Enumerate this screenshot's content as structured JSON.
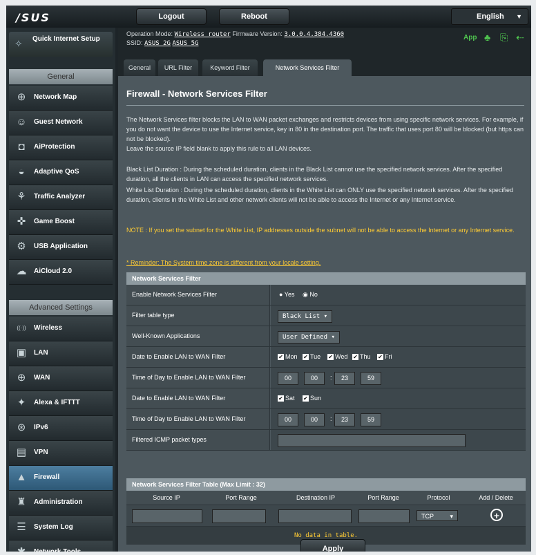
{
  "brand": {
    "logo": "/SUS"
  },
  "topbar": {
    "logout": "Logout",
    "reboot": "Reboot",
    "language": "English",
    "lang_caret": "▼"
  },
  "sidebar": {
    "quick_setup": "Quick Internet Setup",
    "general_header": "General",
    "general_items": [
      {
        "label": "Network Map",
        "icon": "network-map-icon",
        "glyph": "⊕"
      },
      {
        "label": "Guest Network",
        "icon": "guest-network-icon",
        "glyph": "☺"
      },
      {
        "label": "AiProtection",
        "icon": "shield-icon",
        "glyph": "◘"
      },
      {
        "label": "Adaptive QoS",
        "icon": "qos-gauge-icon",
        "glyph": "◒"
      },
      {
        "label": "Traffic Analyzer",
        "icon": "traffic-analyzer-icon",
        "glyph": "⚘"
      },
      {
        "label": "Game Boost",
        "icon": "gamepad-icon",
        "glyph": "✜"
      },
      {
        "label": "USB Application",
        "icon": "usb-application-icon",
        "glyph": "⚙"
      },
      {
        "label": "AiCloud 2.0",
        "icon": "cloud-icon",
        "glyph": "☁"
      }
    ],
    "advanced_header": "Advanced Settings",
    "advanced_items": [
      {
        "label": "Wireless",
        "icon": "wireless-icon",
        "glyph": "((·))"
      },
      {
        "label": "LAN",
        "icon": "lan-icon",
        "glyph": "▣"
      },
      {
        "label": "WAN",
        "icon": "wan-globe-icon",
        "glyph": "⊕"
      },
      {
        "label": "Alexa & IFTTT",
        "icon": "alexa-icon",
        "glyph": "✦"
      },
      {
        "label": "IPv6",
        "icon": "ipv6-icon",
        "glyph": "⊛"
      },
      {
        "label": "VPN",
        "icon": "vpn-icon",
        "glyph": "▤"
      },
      {
        "label": "Firewall",
        "icon": "firewall-icon",
        "glyph": "▲"
      },
      {
        "label": "Administration",
        "icon": "administration-icon",
        "glyph": "♜"
      },
      {
        "label": "System Log",
        "icon": "system-log-icon",
        "glyph": "☰"
      },
      {
        "label": "Network Tools",
        "icon": "network-tools-icon",
        "glyph": "✱"
      }
    ]
  },
  "info": {
    "op_mode_label": "Operation Mode:",
    "op_mode": "Wireless router",
    "fw_label": "Firmware Version:",
    "fw": "3.0.0.4.384.4360",
    "ssid_label": "SSID:",
    "ssid1": "ASUS_2G",
    "ssid2": "ASUS_5G",
    "app": "App"
  },
  "tabs": [
    "General",
    "URL Filter",
    "Keyword Filter",
    "Network Services Filter"
  ],
  "page": {
    "title": "Firewall - Network Services Filter",
    "p1": "The Network Services filter blocks the LAN to WAN packet exchanges and restricts devices from using specific network services. For example, if you do not want the device to use the Internet service, key in 80 in the destination port. The traffic that uses port 80 will be blocked (but https can not be blocked).",
    "p1b": "Leave the source IP field blank to apply this rule to all LAN devices.",
    "p2": "Black List Duration : During the scheduled duration, clients in the Black List cannot use the specified network services. After the specified duration, all the clients in LAN can access the specified network services.",
    "p3": "White List Duration : During the scheduled duration, clients in the White List can ONLY use the specified network services. After the specified duration, clients in the White List and other network clients will not be able to access the Internet or any Internet service.",
    "note": "NOTE : If you set the subnet for the White List, IP addresses outside the subnet will not be able to access the Internet or any Internet service.",
    "reminder": "* Reminder: The System time zone is different from your locale setting."
  },
  "form": {
    "header": "Network Services Filter",
    "enable_label": "Enable Network Services Filter",
    "yes": "Yes",
    "no": "No",
    "filter_type_label": "Filter table type",
    "filter_type": "Black List",
    "known_apps_label": "Well-Known Applications",
    "known_apps": "User Defined",
    "weekday_label": "Date to Enable LAN to WAN Filter",
    "weekdays": [
      "Mon",
      "Tue",
      "Wed",
      "Thu",
      "Fri"
    ],
    "weekday_time_label": "Time of Day to Enable LAN to WAN Filter",
    "weekday_time": [
      "00",
      "00",
      "23",
      "59"
    ],
    "weekend_label": "Date to Enable LAN to WAN Filter",
    "weekend": [
      "Sat",
      "Sun"
    ],
    "weekend_time_label": "Time of Day to Enable LAN to WAN Filter",
    "weekend_time": [
      "00",
      "00",
      "23",
      "59"
    ],
    "icmp_label": "Filtered ICMP packet types",
    "colon": ":"
  },
  "list": {
    "header": "Network Services Filter Table (Max Limit : 32)",
    "columns": [
      "Source IP",
      "Port Range",
      "Destination IP",
      "Port Range",
      "Protocol",
      "Add / Delete"
    ],
    "protocol": "TCP",
    "no_data": "No data in table.",
    "apply": "Apply"
  },
  "colors": {
    "accent_green": "#4fc44f",
    "note_yellow": "#ffcc33",
    "active_blue": "#4d7ea0"
  }
}
